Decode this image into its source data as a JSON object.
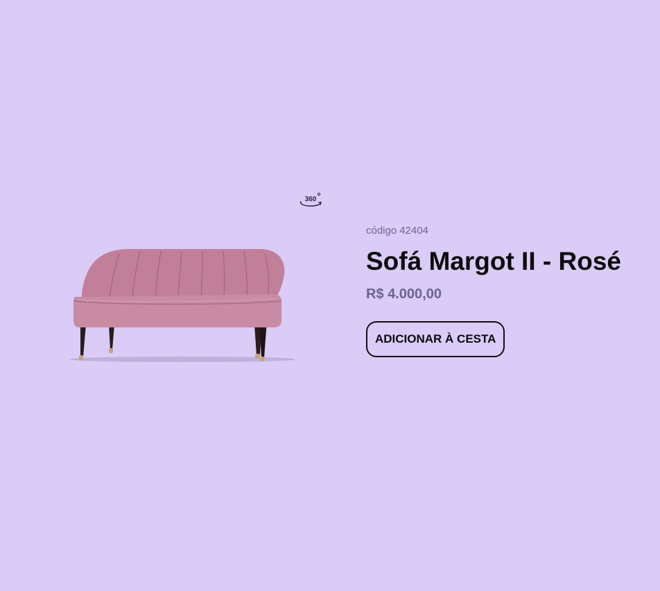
{
  "viewer": {
    "icon": "360-view-icon",
    "icon_text": "360"
  },
  "product": {
    "image_alt": "Sofá Margot II - Rosé",
    "code_label": "código",
    "code_value": "42404",
    "title": "Sofá Margot II - Rosé",
    "price": "R$ 4.000,00",
    "add_to_cart_label": "ADICIONAR À CESTA"
  },
  "colors": {
    "background": "#dacbf7",
    "sofa": "#c9849f",
    "price": "#6a6490",
    "code": "#6e6690"
  }
}
